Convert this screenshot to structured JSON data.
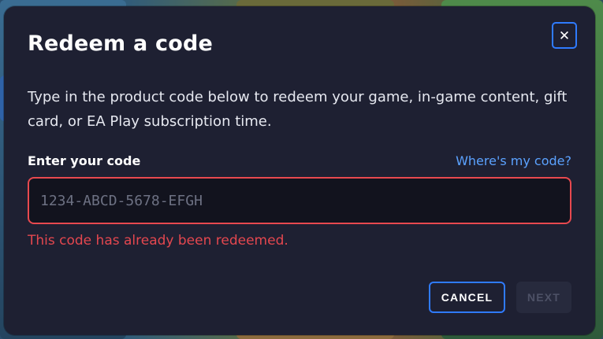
{
  "dialog": {
    "title": "Redeem a code",
    "close_glyph": "✕",
    "description": "Type in the product code below to redeem your game, in-game content, gift card, or EA Play subscription time.",
    "code_label": "Enter your code",
    "help_link": "Where's my code?",
    "code_input": {
      "value": "",
      "placeholder": "1234-ABCD-5678-EFGH"
    },
    "error_message": "This code has already been redeemed.",
    "cancel_label": "CANCEL",
    "next_label": "NEXT"
  },
  "colors": {
    "dialog_background": "#1e2032",
    "accent_blue": "#2f7bff",
    "link_blue": "#5ba2ff",
    "error_red": "#e4474f",
    "disabled_text": "#4d5166"
  },
  "icons": {
    "close": "close-icon"
  }
}
